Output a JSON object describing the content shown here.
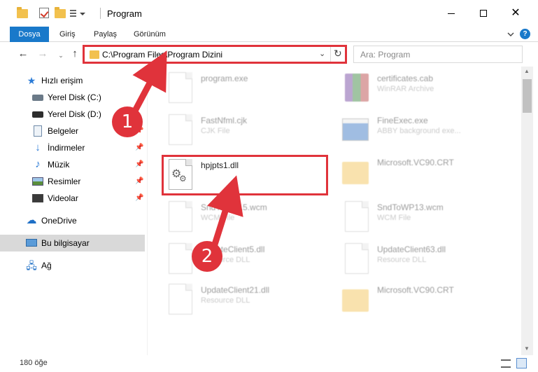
{
  "window": {
    "title": "Program",
    "minimize": "—",
    "maximize": "☐",
    "close": "✕"
  },
  "ribbon": {
    "tabs": [
      "Dosya",
      "Giriş",
      "Paylaş",
      "Görünüm"
    ]
  },
  "navigation": {
    "back": "←",
    "forward": "→",
    "recent": "⌄",
    "up": "↑",
    "address": "C:\\Program Files\\Program Dizini",
    "refresh": "↻",
    "dropdown": "⌄",
    "search_placeholder": "Ara: Program"
  },
  "sidebar": {
    "items": [
      {
        "label": "Hızlı erişim",
        "icon": "star-icon"
      },
      {
        "label": "Yerel Disk (C:)",
        "icon": "drive-icon"
      },
      {
        "label": "Yerel Disk (D:)",
        "icon": "drive-icon"
      },
      {
        "label": "Belgeler",
        "icon": "documents-icon"
      },
      {
        "label": "İndirmeler",
        "icon": "downloads-icon"
      },
      {
        "label": "Müzik",
        "icon": "music-icon"
      },
      {
        "label": "Resimler",
        "icon": "pictures-icon"
      },
      {
        "label": "Videolar",
        "icon": "videos-icon"
      },
      {
        "label": "OneDrive",
        "icon": "cloud-icon"
      },
      {
        "label": "Bu bilgisayar",
        "icon": "computer-icon"
      },
      {
        "label": "Ağ",
        "icon": "network-icon"
      }
    ]
  },
  "files": [
    {
      "name": "program.exe",
      "type": ""
    },
    {
      "name": "certificates.cab",
      "type": "WinRAR Archive"
    },
    {
      "name": "FastNfml.cjk",
      "type": "CJK File"
    },
    {
      "name": "FineExec.exe",
      "type": "ABBY background exe..."
    },
    {
      "name": "hpjpts1.dll",
      "type": ""
    },
    {
      "name": "Microsoft.VC90.CRT",
      "type": ""
    },
    {
      "name": "SndToWP15.wcm",
      "type": "WCM File"
    },
    {
      "name": "SndToWP13.wcm",
      "type": "WCM File"
    },
    {
      "name": "UpdateClient5.dll",
      "type": "Resource DLL"
    },
    {
      "name": "UpdateClient63.dll",
      "type": "Resource DLL"
    },
    {
      "name": "UpdateClient21.dll",
      "type": "Resource DLL"
    },
    {
      "name": "Microsoft.VC90.CRT",
      "type": ""
    }
  ],
  "status": {
    "count": "180 öğe"
  },
  "annotations": {
    "step1": "1",
    "step2": "2",
    "color": "#e0333b"
  },
  "colors": {
    "accent": "#1979ca",
    "selected_nav": "#d9d9d9",
    "folder": "#f2c14e"
  }
}
